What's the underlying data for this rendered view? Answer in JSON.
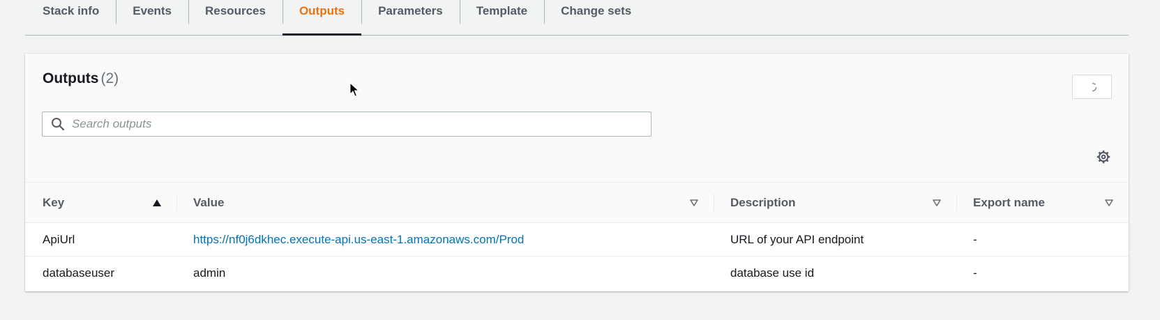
{
  "tabs": [
    {
      "label": "Stack info",
      "active": false
    },
    {
      "label": "Events",
      "active": false
    },
    {
      "label": "Resources",
      "active": false
    },
    {
      "label": "Outputs",
      "active": true
    },
    {
      "label": "Parameters",
      "active": false
    },
    {
      "label": "Template",
      "active": false
    },
    {
      "label": "Change sets",
      "active": false
    }
  ],
  "panel": {
    "title": "Outputs",
    "count": "(2)"
  },
  "search": {
    "placeholder": "Search outputs",
    "value": ""
  },
  "icons": {
    "search": "search-icon",
    "refresh": "spinner-icon",
    "settings": "gear-icon",
    "sort_asc": "caret-up-icon",
    "sort_desc": "caret-down-outline-icon"
  },
  "table": {
    "headers": {
      "key": "Key",
      "value": "Value",
      "description": "Description",
      "export_name": "Export name"
    },
    "rows": [
      {
        "key": "ApiUrl",
        "value": "https://nf0j6dkhec.execute-api.us-east-1.amazonaws.com/Prod",
        "value_is_link": true,
        "description": "URL of your API endpoint",
        "export_name": "-"
      },
      {
        "key": "databaseuser",
        "value": "admin",
        "value_is_link": false,
        "description": "database use id",
        "export_name": "-"
      }
    ]
  },
  "colors": {
    "accent": "#ec7211",
    "link": "#0073bb",
    "text": "#16191f",
    "muted": "#545b64"
  }
}
